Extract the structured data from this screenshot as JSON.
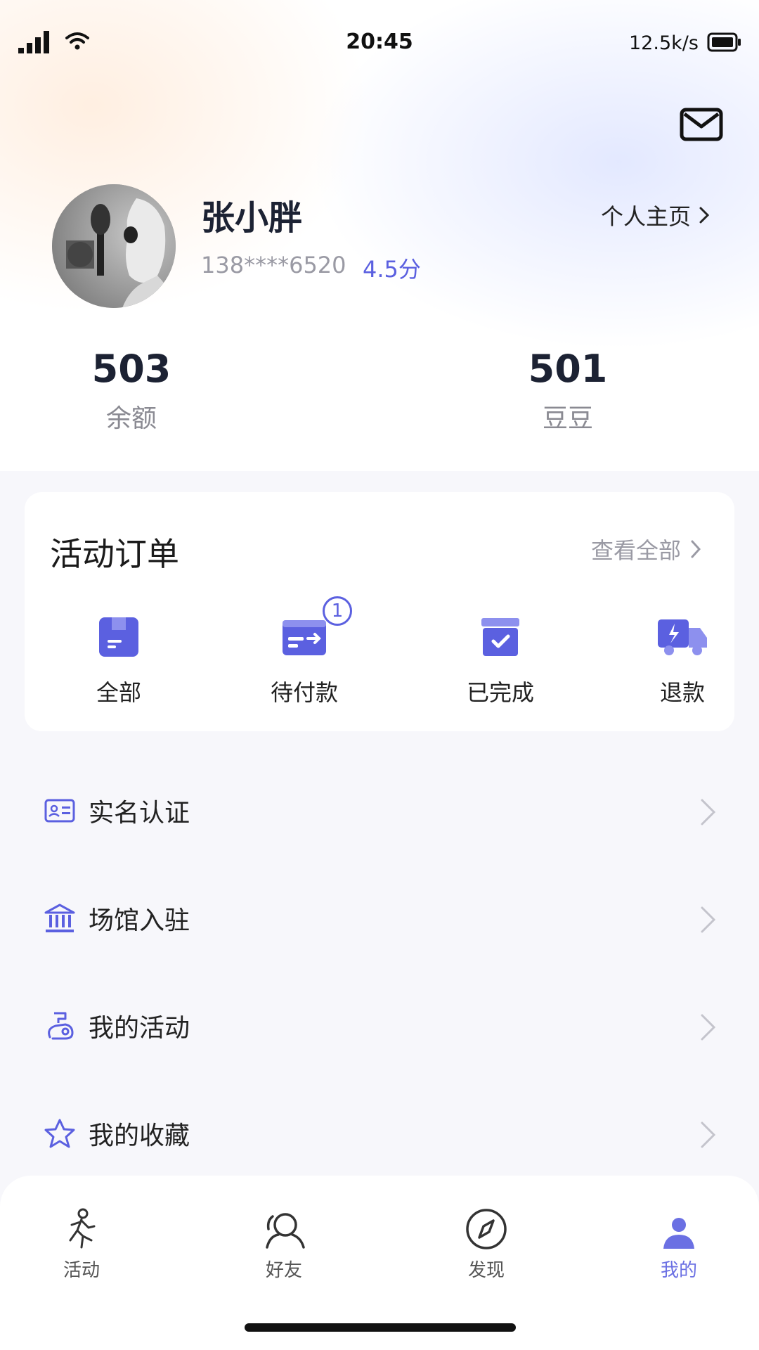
{
  "status_bar": {
    "time": "20:45",
    "net_speed": "12.5k/s"
  },
  "profile": {
    "name": "张小胖",
    "phone": "138****6520",
    "score": "4.5分",
    "homepage_link": "个人主页"
  },
  "stats": [
    {
      "value": "503",
      "label": "余额"
    },
    {
      "value": "501",
      "label": "豆豆"
    }
  ],
  "orders": {
    "title": "活动订单",
    "view_all": "查看全部",
    "items": [
      {
        "label": "全部",
        "icon": "box-icon"
      },
      {
        "label": "待付款",
        "icon": "card-payment-icon",
        "badge": "1"
      },
      {
        "label": "已完成",
        "icon": "check-box-icon"
      },
      {
        "label": "退款",
        "icon": "truck-icon"
      }
    ]
  },
  "menu": [
    {
      "label": "实名认证",
      "icon": "id-card-icon"
    },
    {
      "label": "场馆入驻",
      "icon": "building-icon"
    },
    {
      "label": "我的活动",
      "icon": "activity-icon"
    },
    {
      "label": "我的收藏",
      "icon": "star-icon"
    }
  ],
  "tabs": [
    {
      "label": "活动",
      "icon": "running-icon"
    },
    {
      "label": "好友",
      "icon": "friends-icon"
    },
    {
      "label": "发现",
      "icon": "compass-icon"
    },
    {
      "label": "我的",
      "icon": "user-icon",
      "active": true
    }
  ],
  "colors": {
    "accent": "#5b60e0",
    "tab_active": "#6b70e3"
  }
}
